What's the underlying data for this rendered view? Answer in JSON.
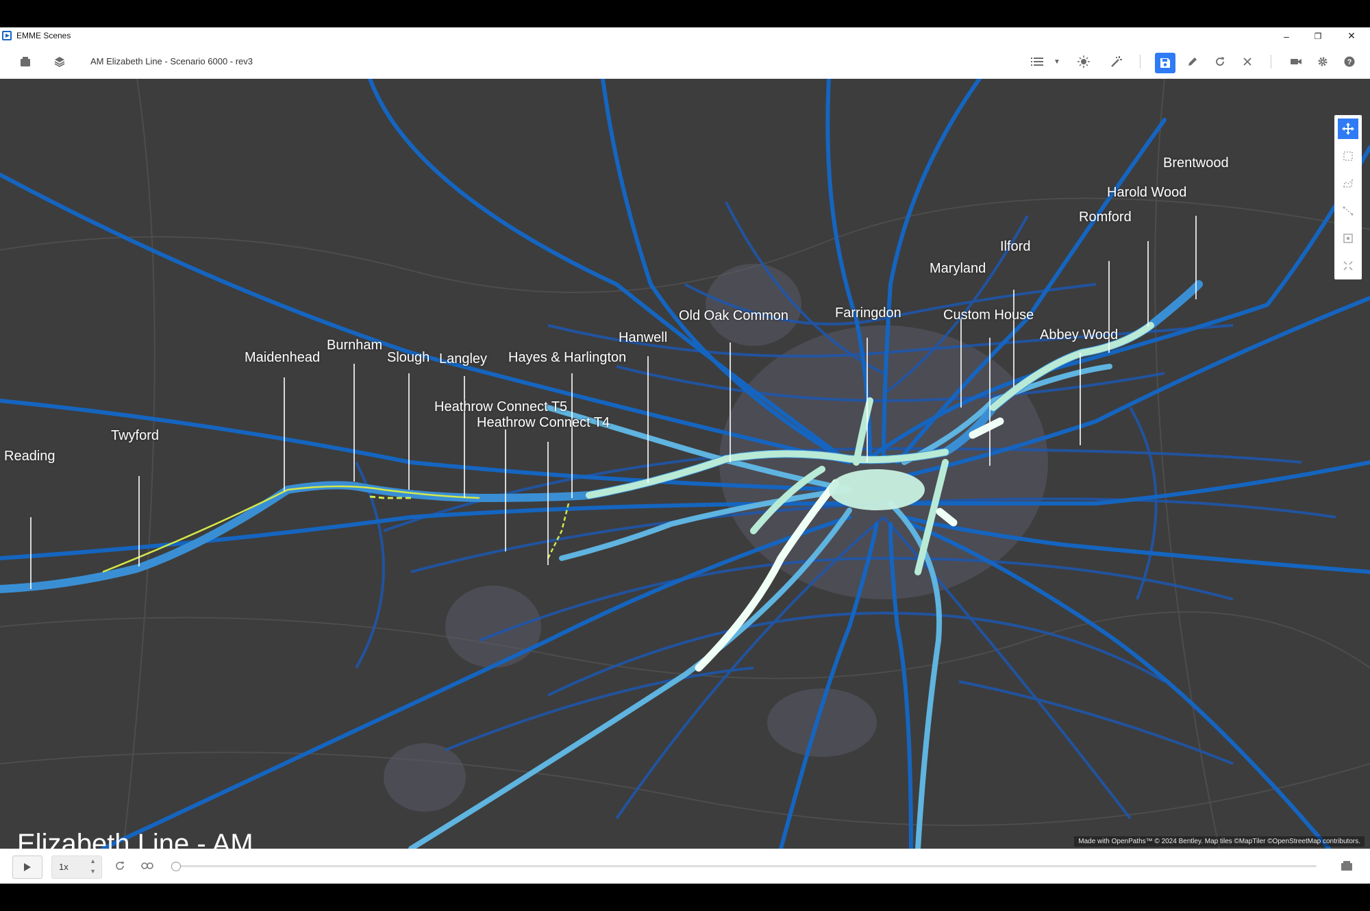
{
  "app": {
    "title": "EMME Scenes"
  },
  "window_controls": {
    "minimize": "–",
    "restore": "❐",
    "close": "✕"
  },
  "toolbar": {
    "scene_name": "AM Elizabeth Line - Scenario 6000 - rev3"
  },
  "map": {
    "caption": "Elizabeth Line - AM",
    "attribution": "Made with OpenPaths™ © 2024 Bentley.   Map tiles ©MapTiler ©OpenStreetMap contributors.",
    "stations": [
      "Reading",
      "Twyford",
      "Maidenhead",
      "Burnham",
      "Slough",
      "Langley",
      "Hayes & Harlington",
      "Heathrow Connect T5",
      "Heathrow Connect T4",
      "Hanwell",
      "Old Oak Common",
      "Farringdon",
      "Custom House",
      "Maryland",
      "Ilford",
      "Romford",
      "Harold Wood",
      "Brentwood",
      "Abbey Wood"
    ]
  },
  "playback": {
    "speed": "1x"
  },
  "colors": {
    "accent": "#2f7bf5",
    "map_bg": "#3d3d3d",
    "network": "#1565c0",
    "high_flow": "#c8f0e0",
    "elizabeth_line": "#d4e84a"
  }
}
